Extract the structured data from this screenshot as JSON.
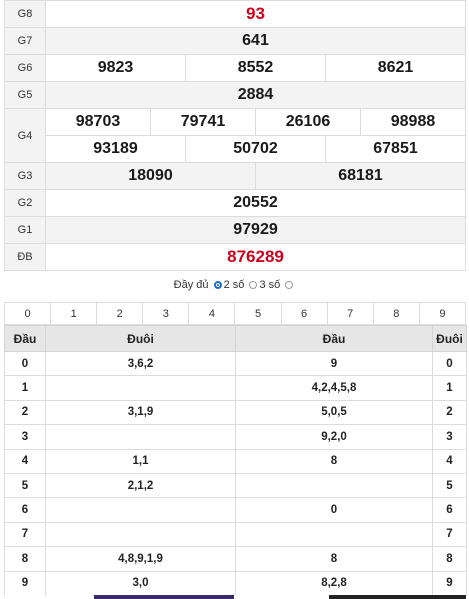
{
  "prizes": {
    "g8": {
      "label": "G8",
      "values": [
        "93"
      ]
    },
    "g7": {
      "label": "G7",
      "values": [
        "641"
      ]
    },
    "g6": {
      "label": "G6",
      "values": [
        "9823",
        "8552",
        "8621"
      ]
    },
    "g5": {
      "label": "G5",
      "values": [
        "2884"
      ]
    },
    "g4": {
      "label": "G4",
      "values": [
        "98703",
        "79741",
        "26106",
        "98988",
        "93189",
        "50702",
        "67851"
      ]
    },
    "g3": {
      "label": "G3",
      "values": [
        "18090",
        "68181"
      ]
    },
    "g2": {
      "label": "G2",
      "values": [
        "20552"
      ]
    },
    "g1": {
      "label": "G1",
      "values": [
        "97929"
      ]
    },
    "db": {
      "label": "ĐB",
      "values": [
        "876289"
      ]
    }
  },
  "options": {
    "full": "Đầy đủ",
    "two": "2 số",
    "three": "3 số",
    "selected": "full"
  },
  "digits": [
    "0",
    "1",
    "2",
    "3",
    "4",
    "5",
    "6",
    "7",
    "8",
    "9"
  ],
  "loto": {
    "headers": {
      "dau1": "Đầu",
      "duoi1": "Đuôi",
      "dau2": "Đầu",
      "duoi2": "Đuôi"
    },
    "rows": [
      {
        "k": "0",
        "tails": "3,6,2",
        "heads": "9",
        "k2": "0"
      },
      {
        "k": "1",
        "tails": "",
        "heads": "4,2,4,5,8",
        "k2": "1"
      },
      {
        "k": "2",
        "tails": "3,1,9",
        "heads": "5,0,5",
        "k2": "2"
      },
      {
        "k": "3",
        "tails": "",
        "heads": "9,2,0",
        "k2": "3"
      },
      {
        "k": "4",
        "tails": "1,1",
        "heads": "8",
        "k2": "4"
      },
      {
        "k": "5",
        "tails": "2,1,2",
        "heads": "",
        "k2": "5"
      },
      {
        "k": "6",
        "tails": "",
        "heads": "0",
        "k2": "6"
      },
      {
        "k": "7",
        "tails": "",
        "heads": "",
        "k2": "7"
      },
      {
        "k": "8",
        "tails": "4,8,9,1,9",
        "heads": "8",
        "k2": "8"
      },
      {
        "k": "9",
        "tails": "3,0",
        "heads": "8,2,8",
        "k2": "9"
      }
    ]
  },
  "colors": {
    "special": "#d0021b",
    "accent": "#1e6fd0"
  }
}
